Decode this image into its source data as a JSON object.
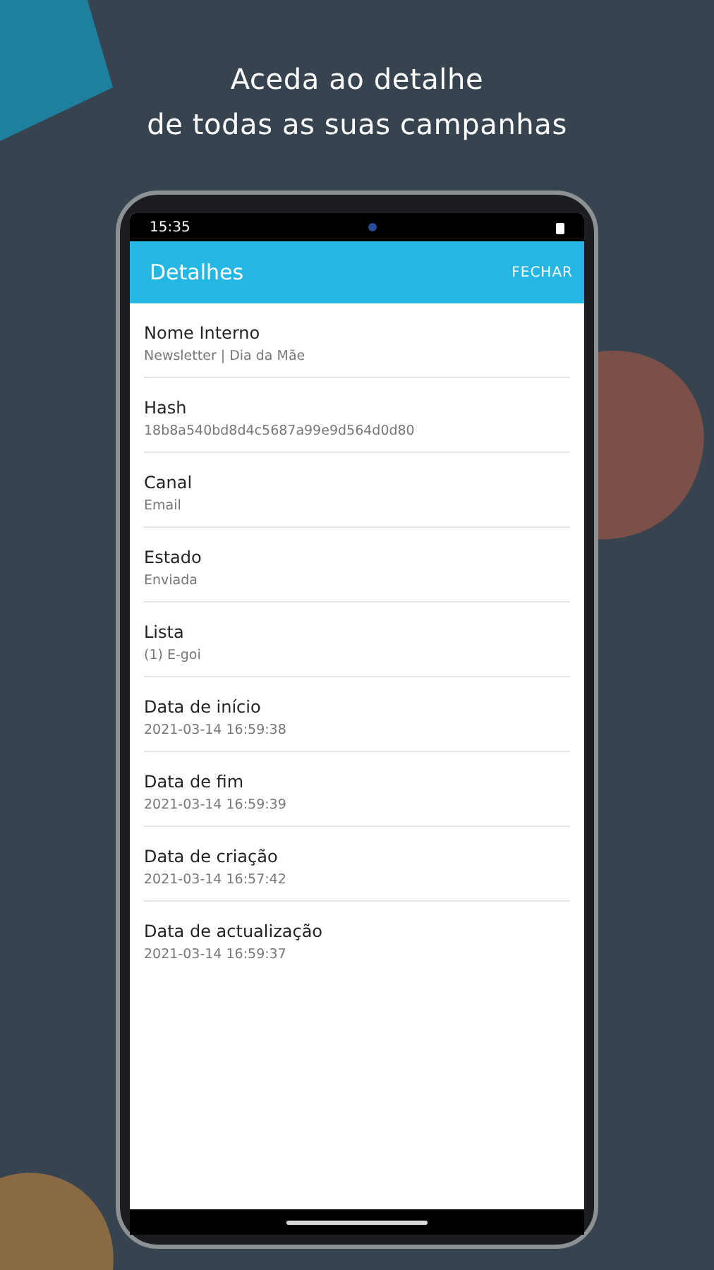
{
  "headline": [
    "Aceda ao detalhe",
    "de todas as suas campanhas"
  ],
  "status_bar": {
    "time": "15:35"
  },
  "app_bar": {
    "title": "Detalhes",
    "action": "FECHAR"
  },
  "details": [
    {
      "label": "Nome Interno",
      "value": "Newsletter | Dia da Mãe"
    },
    {
      "label": "Hash",
      "value": "18b8a540bd8d4c5687a99e9d564d0d80"
    },
    {
      "label": "Canal",
      "value": "Email"
    },
    {
      "label": "Estado",
      "value": "Enviada"
    },
    {
      "label": "Lista",
      "value": "(1) E-goi"
    },
    {
      "label": "Data de início",
      "value": "2021-03-14 16:59:38"
    },
    {
      "label": "Data de fim",
      "value": "2021-03-14 16:59:39"
    },
    {
      "label": "Data de criação",
      "value": "2021-03-14 16:57:42"
    },
    {
      "label": "Data de actualização",
      "value": "2021-03-14 16:59:37"
    }
  ]
}
